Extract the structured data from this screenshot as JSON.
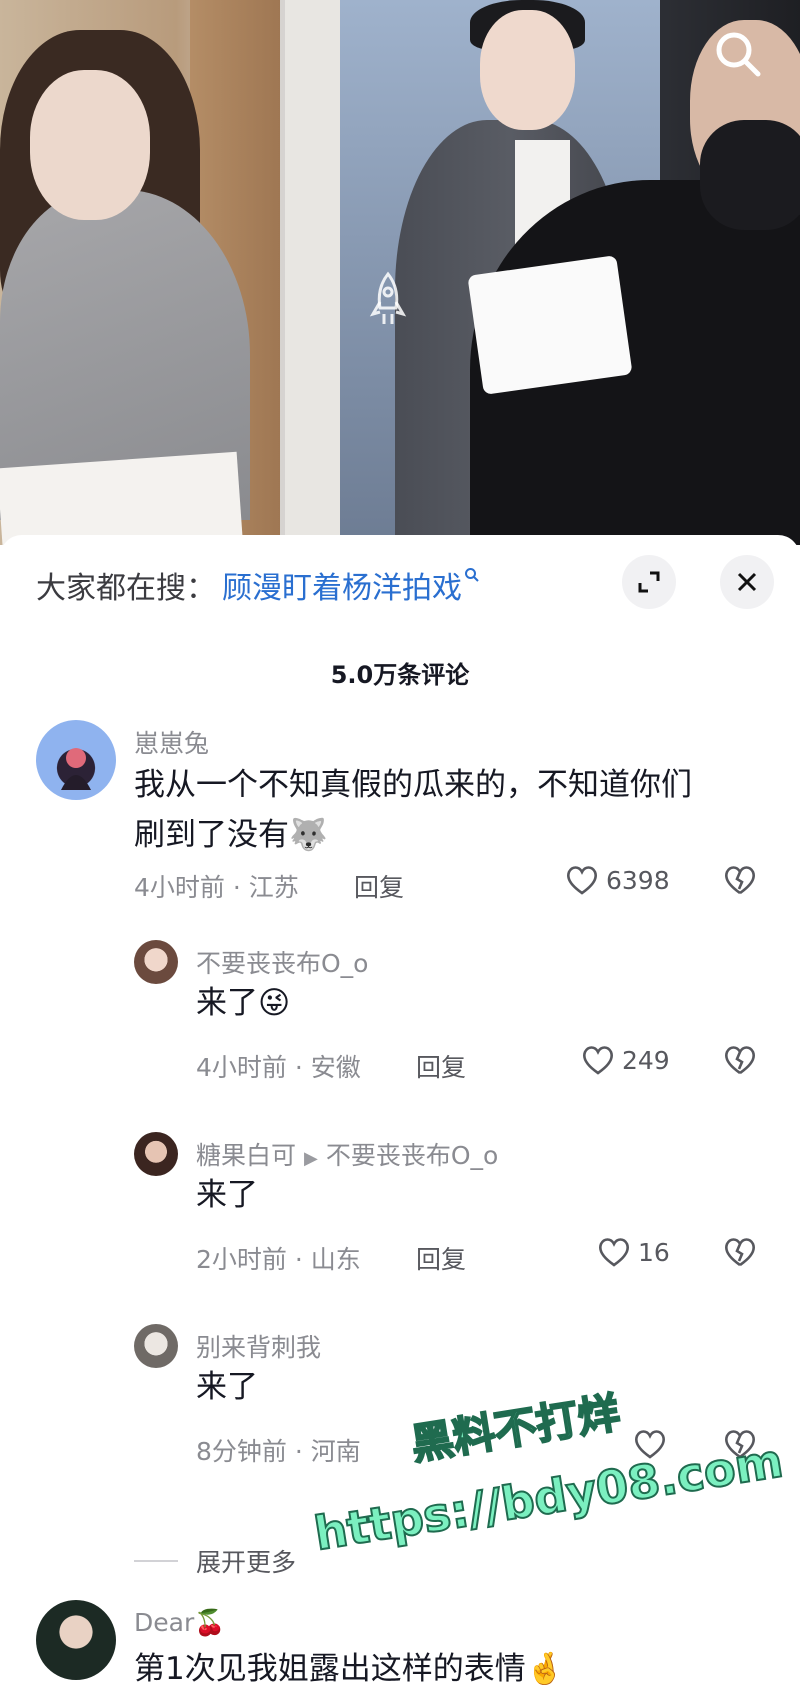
{
  "video": {
    "search_icon": "search-icon"
  },
  "sheet": {
    "hot_search_label": "大家都在搜：",
    "hot_search_query": "顾漫盯着杨洋拍戏",
    "comment_count": "5.0万条评论"
  },
  "comments": [
    {
      "username": "崽崽兔",
      "text_line1": "我从一个不知真假的瓜来的，不知道你们",
      "text_line2": "刷到了没有",
      "text_emoji": "🐺",
      "meta": "4小时前 · 江苏",
      "reply": "回复",
      "likes": "6398"
    },
    {
      "username": "不要丧丧布O_o",
      "text": "来了",
      "text_emoji": "😜",
      "meta": "4小时前 · 安徽",
      "reply": "回复",
      "likes": "249"
    },
    {
      "username": "糖果白可",
      "reply_to": "不要丧丧布O_o",
      "text": "来了",
      "meta": "2小时前 · 山东",
      "reply": "回复",
      "likes": "16"
    },
    {
      "username": "别来背刺我",
      "text": "来了",
      "meta": "8分钟前 · 河南",
      "reply": "回复",
      "likes": ""
    },
    {
      "username": "Dear",
      "username_emoji": "🍒",
      "text": "第1次见我姐露出这样的表情",
      "text_emoji": "🤞"
    }
  ],
  "expand_more": "展开更多",
  "watermark": {
    "line1": "黑料不打烊",
    "line2": "https://bdy08.com"
  }
}
